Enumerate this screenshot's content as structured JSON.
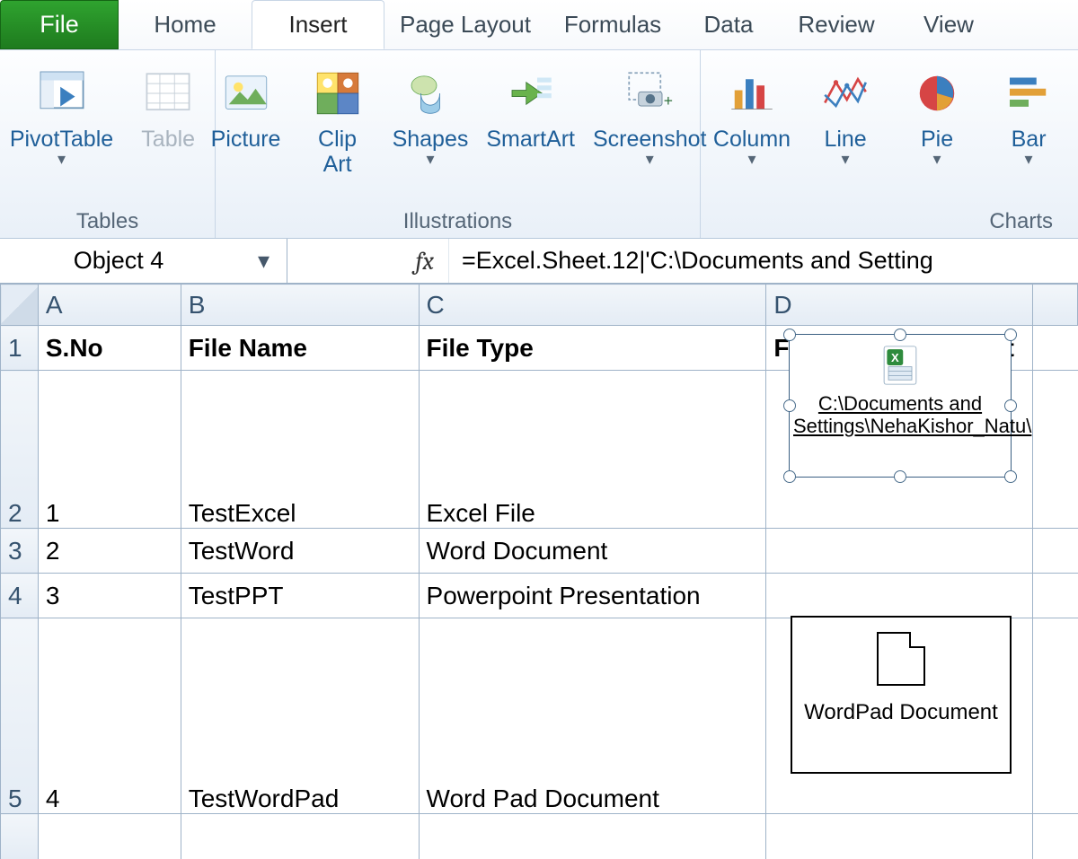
{
  "tabs": {
    "file": "File",
    "items": [
      "Home",
      "Insert",
      "Page Layout",
      "Formulas",
      "Data",
      "Review",
      "View"
    ],
    "active": "Insert"
  },
  "ribbon": {
    "groups": [
      {
        "label": "Tables",
        "items": [
          {
            "id": "pivottable",
            "label": "PivotTable",
            "dropdown": true,
            "enabled": true
          },
          {
            "id": "table",
            "label": "Table",
            "dropdown": false,
            "enabled": false
          }
        ]
      },
      {
        "label": "Illustrations",
        "items": [
          {
            "id": "picture",
            "label": "Picture",
            "dropdown": false,
            "enabled": true
          },
          {
            "id": "clipart",
            "label": "Clip\nArt",
            "dropdown": false,
            "enabled": true
          },
          {
            "id": "shapes",
            "label": "Shapes",
            "dropdown": true,
            "enabled": true
          },
          {
            "id": "smartart",
            "label": "SmartArt",
            "dropdown": false,
            "enabled": true
          },
          {
            "id": "screenshot",
            "label": "Screenshot",
            "dropdown": true,
            "enabled": true
          }
        ]
      },
      {
        "label": "Charts",
        "items": [
          {
            "id": "column",
            "label": "Column",
            "dropdown": true,
            "enabled": true
          },
          {
            "id": "line",
            "label": "Line",
            "dropdown": true,
            "enabled": true
          },
          {
            "id": "pie",
            "label": "Pie",
            "dropdown": true,
            "enabled": true
          },
          {
            "id": "bar",
            "label": "Bar",
            "dropdown": true,
            "enabled": true
          }
        ]
      }
    ]
  },
  "formula_bar": {
    "name_box": "Object 4",
    "fx": "fx",
    "formula": "=Excel.Sheet.12|'C:\\Documents and Setting"
  },
  "columns": [
    "A",
    "B",
    "C",
    "D"
  ],
  "sheet": {
    "headers": {
      "r": "1",
      "a": "S.No",
      "b": "File Name",
      "c": "File Type",
      "d": "File added as object"
    },
    "rows": [
      {
        "r": "2",
        "a": "1",
        "b": "TestExcel",
        "c": "Excel File"
      },
      {
        "r": "3",
        "a": "2",
        "b": "TestWord",
        "c": "Word Document"
      },
      {
        "r": "4",
        "a": "3",
        "b": "TestPPT",
        "c": "Powerpoint Presentation"
      },
      {
        "r": "5",
        "a": "4",
        "b": "TestWordPad",
        "c": "Word Pad Document"
      }
    ]
  },
  "objects": {
    "excel": {
      "caption": "C:\\Documents and Settings\\NehaKishor_Natu\\"
    },
    "wordpad": {
      "caption": "WordPad Document"
    }
  }
}
